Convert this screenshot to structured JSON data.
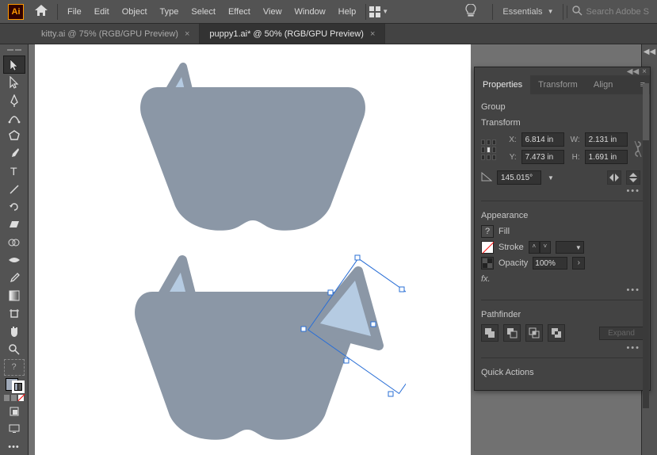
{
  "app": {
    "logo": "Ai"
  },
  "menu": {
    "items": [
      "File",
      "Edit",
      "Object",
      "Type",
      "Select",
      "Effect",
      "View",
      "Window",
      "Help"
    ],
    "workspace_label": "Essentials",
    "search_placeholder": "Search Adobe S"
  },
  "tabs": {
    "items": [
      {
        "label": "kitty.ai @ 75% (RGB/GPU Preview)",
        "active": false
      },
      {
        "label": "puppy1.ai* @ 50% (RGB/GPU Preview)",
        "active": true
      }
    ]
  },
  "panel": {
    "tabs": [
      "Properties",
      "Transform",
      "Align"
    ],
    "active_tab": 0,
    "selection_label": "Group",
    "transform": {
      "title": "Transform",
      "x_label": "X:",
      "y_label": "Y:",
      "w_label": "W:",
      "h_label": "H:",
      "x": "6.814 in",
      "y": "7.473 in",
      "w": "2.131 in",
      "h": "1.691 in",
      "angle": "145.015°"
    },
    "appearance": {
      "title": "Appearance",
      "fill_label": "Fill",
      "stroke_label": "Stroke",
      "opacity_label": "Opacity",
      "opacity": "100%",
      "fx_label": "fx."
    },
    "pathfinder": {
      "title": "Pathfinder",
      "expand_label": "Expand"
    },
    "quick_actions": {
      "title": "Quick Actions"
    }
  },
  "artwork": {
    "fill_body": "#8b97a6",
    "fill_ear_inner": "#b5cbe2",
    "selection_stroke": "#2a6fd6"
  }
}
